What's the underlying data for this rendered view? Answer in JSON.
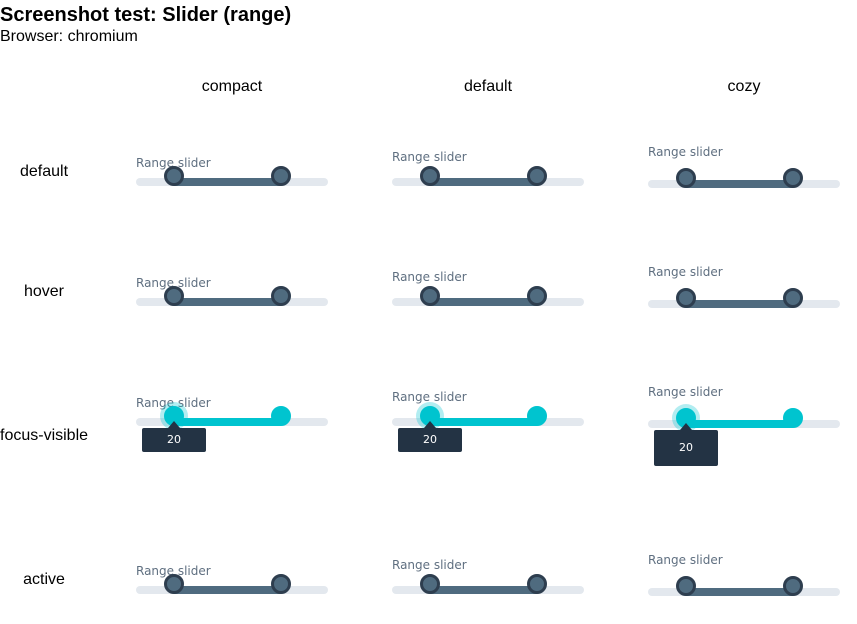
{
  "page": {
    "title": "Screenshot test: Slider (range)",
    "browser": "Browser: chromium"
  },
  "columns": [
    "compact",
    "default",
    "cozy"
  ],
  "rows": [
    "default",
    "hover",
    "focus-visible",
    "active"
  ],
  "slider": {
    "label": "Range slider",
    "min_value": 20,
    "tooltip_value": "20"
  },
  "colors": {
    "track": "#e3e8ee",
    "fill": "#4f6b7f",
    "handle_border": "#2e3e4f",
    "focus_accent": "#00c4cf",
    "tooltip_bg": "#233344",
    "label": "#5f6f80"
  }
}
